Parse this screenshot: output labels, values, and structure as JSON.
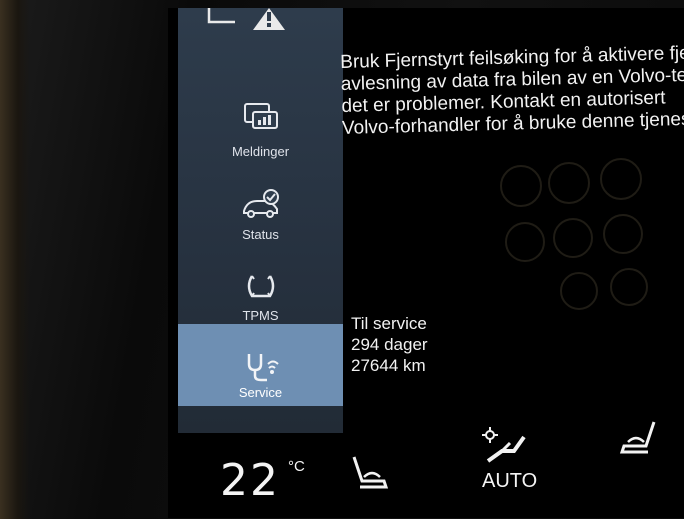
{
  "sidebar": {
    "items": [
      {
        "label": "Meldinger",
        "icon": "messages-icon"
      },
      {
        "label": "Status",
        "icon": "car-status-icon"
      },
      {
        "label": "TPMS",
        "icon": "tire-pressure-icon"
      },
      {
        "label": "Service",
        "icon": "stethoscope-icon",
        "active": true
      }
    ],
    "top_icon": "warning-triangle-icon"
  },
  "main": {
    "lines": [
      "Bruk Fjernstyrt feilsøking for å aktivere fjer",
      "avlesning av data fra bilen av en Volvo-tekn",
      "det er problemer. Kontakt en autorisert",
      "Volvo-forhandler for å bruke denne tjeneste"
    ],
    "service": {
      "title": "Til service",
      "days": "294 dager",
      "distance": "27644 km"
    }
  },
  "climate": {
    "temperature": "22",
    "unit": "°C",
    "auto_label": "AUTO",
    "icons": [
      "seat-heat-icon",
      "fan-auto-icon",
      "seat-heat-right-icon"
    ]
  },
  "colors": {
    "sidebar_bg": "#2b3846",
    "active_bg": "#6e8fb3",
    "text": "#f2f2f2"
  }
}
